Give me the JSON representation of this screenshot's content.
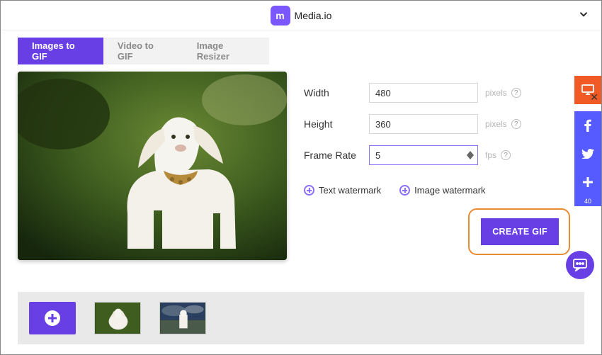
{
  "header": {
    "brand": "Media.io",
    "brand_logo_letter": "m"
  },
  "tabs": {
    "active": 0,
    "items": [
      "Images to GIF",
      "Video to GIF",
      "Image Resizer"
    ]
  },
  "fields": {
    "width": {
      "label": "Width",
      "value": "480",
      "unit": "pixels"
    },
    "height": {
      "label": "Height",
      "value": "360",
      "unit": "pixels"
    },
    "framerate": {
      "label": "Frame Rate",
      "value": "5",
      "unit": "fps"
    }
  },
  "watermark": {
    "text_label": "Text watermark",
    "image_label": "Image watermark"
  },
  "cta": "CREATE GIF",
  "side_rail": {
    "share_count": "40"
  },
  "thumbs": {
    "count": 2
  }
}
